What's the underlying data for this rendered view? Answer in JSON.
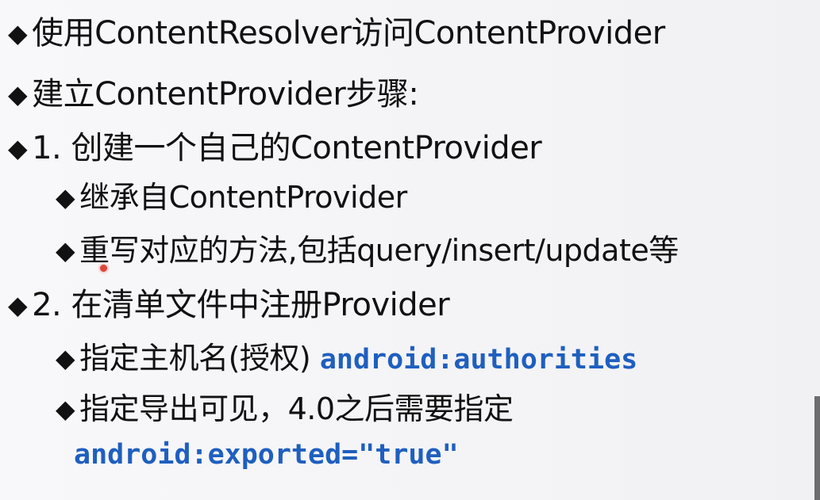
{
  "slide": {
    "bullet_glyph": "◆",
    "lines": [
      {
        "text": "使用ContentResolver访问ContentProvider"
      },
      {
        "text": "建立ContentProvider步骤:"
      },
      {
        "text": "1. 创建一个自己的ContentProvider"
      },
      {
        "text": "继承自ContentProvider"
      },
      {
        "text": "重写对应的方法,包括query/insert/update等"
      },
      {
        "text": "2. 在清单文件中注册Provider"
      },
      {
        "text": "指定主机名(授权) ",
        "code": "android:authorities"
      },
      {
        "text": "指定导出可见，4.0之后需要指定"
      },
      {
        "code": "android:exported=\"true\""
      }
    ]
  },
  "colors": {
    "text": "#111111",
    "code": "#1f5fbf",
    "cursor": "#e0453a"
  }
}
